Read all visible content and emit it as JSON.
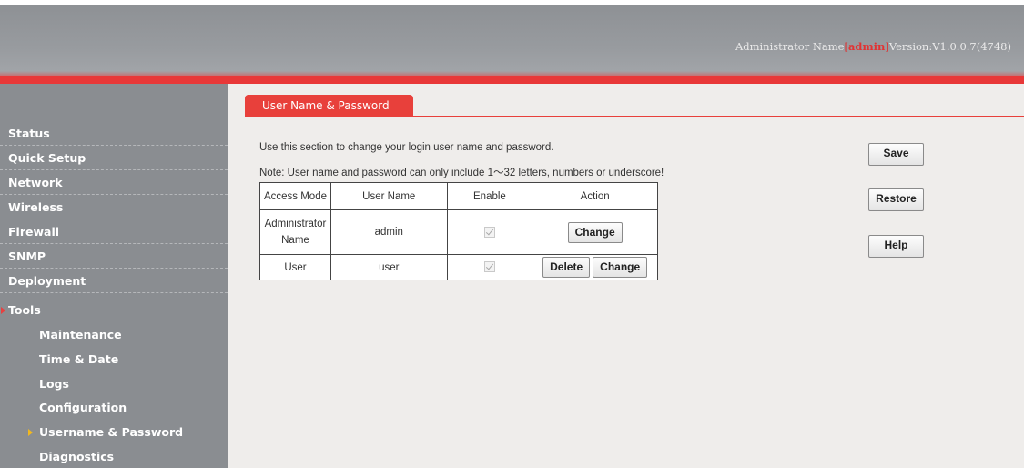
{
  "header": {
    "admin_label": "Administrator Name",
    "admin_name": "admin",
    "version": "Version:V1.0.0.7(4748)",
    "bracket_open": "[",
    "bracket_close": "]"
  },
  "sidebar": {
    "items": [
      {
        "label": "Status"
      },
      {
        "label": "Quick Setup"
      },
      {
        "label": "Network"
      },
      {
        "label": "Wireless"
      },
      {
        "label": "Firewall"
      },
      {
        "label": "SNMP"
      },
      {
        "label": "Deployment"
      },
      {
        "label": "Tools"
      }
    ],
    "sub_items": [
      {
        "label": "Maintenance"
      },
      {
        "label": "Time & Date"
      },
      {
        "label": "Logs"
      },
      {
        "label": "Configuration"
      },
      {
        "label": "Username & Password"
      },
      {
        "label": "Diagnostics"
      }
    ],
    "active_item": "Tools",
    "active_sub_item": "Username & Password"
  },
  "main": {
    "tab_label": "User Name & Password",
    "description": "Use this section to change your login user name and password.",
    "note": "Note: User name and password can only include 1～32 letters, numbers or underscore!",
    "table": {
      "headers": [
        "Access Mode",
        "User Name",
        "Enable",
        "Action"
      ],
      "rows": [
        {
          "access_mode_line1": "Administrator",
          "access_mode_line2": "Name",
          "user_name": "admin",
          "enabled": true,
          "actions": [
            "Change"
          ]
        },
        {
          "access_mode": "User",
          "user_name": "user",
          "enabled": true,
          "actions": [
            "Delete",
            "Change"
          ]
        }
      ]
    },
    "buttons": {
      "save": "Save",
      "restore": "Restore",
      "help": "Help"
    }
  },
  "colors": {
    "accent_red": "#e8403b",
    "sidebar_bg": "#8a8d91",
    "content_bg": "#efedeb",
    "active_arrow_yellow": "#f1b81f"
  },
  "icons": {
    "tools_arrow": "caret-right-icon",
    "sub_arrow": "caret-right-icon",
    "checkbox": "checkmark-icon"
  }
}
